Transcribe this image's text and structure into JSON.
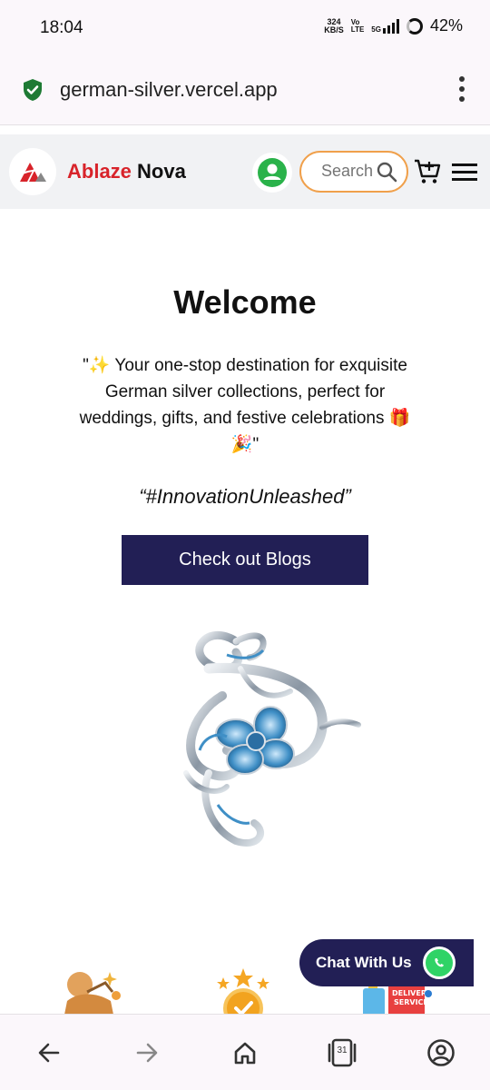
{
  "status_bar": {
    "time": "18:04",
    "network_speed_value": "324",
    "network_speed_unit": "KB/S",
    "volte_top": "Vo",
    "volte_bottom": "LTE",
    "network_type": "5G",
    "battery": "42%"
  },
  "browser": {
    "url": "german-silver.vercel.app",
    "secure_icon": "shield-check-icon",
    "menu_icon": "more-vertical-icon"
  },
  "header": {
    "brand_first": "Ablaze",
    "brand_second": "Nova",
    "search_placeholder": "Search",
    "profile_icon": "user-icon",
    "cart_icon": "cart-icon",
    "menu_icon": "hamburger-icon"
  },
  "hero": {
    "title": "Welcome",
    "tagline": "\"✨ Your one-stop destination for exquisite German silver collections, perfect for weddings, gifts, and festive celebrations 🎁🎉\"",
    "hashtag": "“#InnovationUnleashed”",
    "cta_label": "Check out Blogs"
  },
  "chat": {
    "label": "Chat With Us",
    "icon": "whatsapp-icon"
  },
  "bottom_nav": {
    "tab_count": "31",
    "items": [
      "back-icon",
      "forward-icon",
      "home-icon",
      "tabs-icon",
      "account-icon"
    ]
  },
  "colors": {
    "brand_red": "#d8232a",
    "navy": "#221f55",
    "search_border": "#f0a04b",
    "whatsapp_green": "#2fd366",
    "secure_green": "#1e7a34"
  }
}
